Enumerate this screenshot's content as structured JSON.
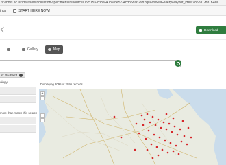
{
  "browser": {
    "url": "ts://hms.ac.uk/datasets/collection-specimens/resource/05f5155-c38a-40b9-be57-4cdb5da6298?q=&view=Gallery&layout_id=ef785781-bb1f-4da..."
  },
  "bookmarks": [
    {
      "label": "ings",
      "icon": "folder-icon"
    },
    {
      "label": "START HERE NOW!",
      "icon": "document-icon"
    }
  ],
  "toolbar": {
    "download_label": "Download"
  },
  "tabs": [
    {
      "label": "",
      "icon": "list-icon",
      "active": false
    },
    {
      "label": "Gallery",
      "icon": "gallery-icon",
      "active": false
    },
    {
      "label": "Map",
      "icon": "map-icon",
      "active": true
    }
  ],
  "search": {
    "placeholder": ""
  },
  "filter_chip": {
    "label": "n: Pauhamt"
  },
  "sidebar": {
    "label": "ology",
    "note": "more than match this search"
  },
  "results": {
    "count_text": "Displaying 2095 of 2095 records"
  },
  "map": {
    "zoom_in": "+",
    "zoom_out": "−",
    "marker_color": "#d6262a"
  }
}
